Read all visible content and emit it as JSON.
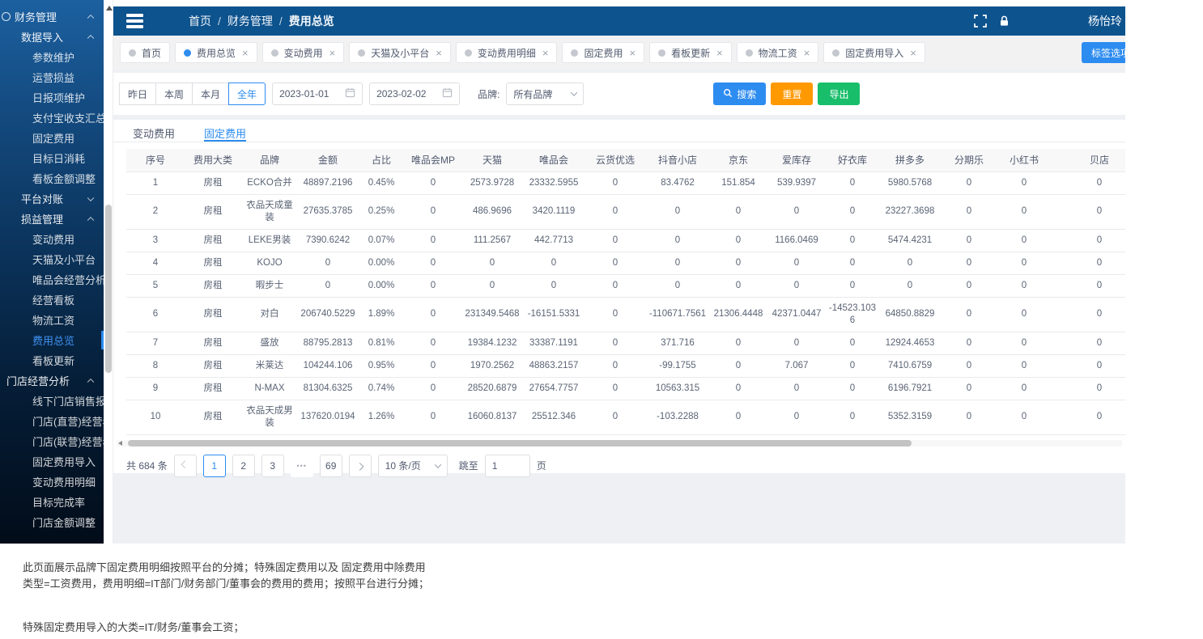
{
  "colors": {
    "primary": "#2d8cf0",
    "warning": "#ff9900",
    "success": "#19be6b",
    "header_bar": "#0d538e",
    "sidebar_active": "#3f92f2"
  },
  "icons": {
    "menu": "hamburger",
    "fullscreen": "corner-brackets",
    "lock": "padlock",
    "search": "magnifier",
    "calendar": "calendar",
    "chevron_down": "chevron-down",
    "close": "x",
    "prev": "chevron-left",
    "next": "chevron-right",
    "scroll_up": "triangle-up",
    "scroll_left": "triangle-left"
  },
  "sidebar": {
    "items": [
      {
        "label": "财务管理",
        "level": 0,
        "arrow": "up",
        "icon": true
      },
      {
        "label": "数据导入",
        "level": 1,
        "arrow": "up"
      },
      {
        "label": "参数维护",
        "level": 2
      },
      {
        "label": "运营损益",
        "level": 2
      },
      {
        "label": "日报项维护",
        "level": 2
      },
      {
        "label": "支付宝收支汇总",
        "level": 2
      },
      {
        "label": "固定费用",
        "level": 2
      },
      {
        "label": "目标日消耗",
        "level": 2
      },
      {
        "label": "看板金额调整",
        "level": 2
      },
      {
        "label": "平台对账",
        "level": 1,
        "arrow": "down"
      },
      {
        "label": "损益管理",
        "level": 1,
        "arrow": "up"
      },
      {
        "label": "变动费用",
        "level": 2
      },
      {
        "label": "天猫及小平台",
        "level": 2
      },
      {
        "label": "唯品会经营分析",
        "level": 2
      },
      {
        "label": "经营看板",
        "level": 2
      },
      {
        "label": "物流工资",
        "level": 2
      },
      {
        "label": "费用总览",
        "level": 2,
        "active": true
      },
      {
        "label": "看板更新",
        "level": 2
      },
      {
        "label": "门店经营分析",
        "level": 0,
        "arrow": "up"
      },
      {
        "label": "线下门店销售报表",
        "level": 2
      },
      {
        "label": "门店(直营)经营看板",
        "level": 2
      },
      {
        "label": "门店(联营)经营看板",
        "level": 2
      },
      {
        "label": "固定费用导入",
        "level": 2
      },
      {
        "label": "变动费用明细",
        "level": 2
      },
      {
        "label": "目标完成率",
        "level": 2
      },
      {
        "label": "门店金额调整",
        "level": 2
      }
    ]
  },
  "header": {
    "breadcrumb": {
      "items": [
        "首页",
        "财务管理",
        "费用总览"
      ],
      "separator": "/"
    },
    "user": "杨怡玲"
  },
  "tabbar": {
    "tabs": [
      {
        "label": "首页",
        "closable": false
      },
      {
        "label": "费用总览",
        "closable": true,
        "active": true
      },
      {
        "label": "变动费用",
        "closable": true
      },
      {
        "label": "天猫及小平台",
        "closable": true
      },
      {
        "label": "变动费用明细",
        "closable": true
      },
      {
        "label": "固定费用",
        "closable": true
      },
      {
        "label": "看板更新",
        "closable": true
      },
      {
        "label": "物流工资",
        "closable": true
      },
      {
        "label": "固定费用导入",
        "closable": true
      }
    ],
    "tag_button": "标签选项"
  },
  "filters": {
    "quick": [
      {
        "label": "昨日"
      },
      {
        "label": "本周"
      },
      {
        "label": "本月"
      },
      {
        "label": "全年",
        "active": true
      }
    ],
    "date_start": "2023-01-01",
    "date_end": "2023-02-02",
    "brand_label": "品牌:",
    "brand_value": "所有品牌",
    "search_label": "搜索",
    "reset_label": "重置",
    "export_label": "导出"
  },
  "subtabs": [
    {
      "label": "变动费用"
    },
    {
      "label": "固定费用",
      "active": true
    }
  ],
  "table": {
    "columns": [
      "序号",
      "费用大类",
      "品牌",
      "金额",
      "占比",
      "唯品会MP",
      "天猫",
      "唯品会",
      "云货优选",
      "抖音小店",
      "京东",
      "爱库存",
      "好衣库",
      "拼多多",
      "分期乐",
      "小红书",
      "贝店"
    ],
    "rows": [
      [
        "1",
        "房租",
        "ECKO合并",
        "48897.2196",
        "0.45%",
        "0",
        "2573.9728",
        "23332.5955",
        "0",
        "83.4762",
        "151.854",
        "539.9397",
        "0",
        "5980.5768",
        "0",
        "0",
        "0"
      ],
      [
        "2",
        "房租",
        "衣品天成童装",
        "27635.3785",
        "0.25%",
        "0",
        "486.9696",
        "3420.1119",
        "0",
        "0",
        "0",
        "0",
        "0",
        "23227.3698",
        "0",
        "0",
        "0"
      ],
      [
        "3",
        "房租",
        "LEKE男装",
        "7390.6242",
        "0.07%",
        "0",
        "111.2567",
        "442.7713",
        "0",
        "0",
        "0",
        "1166.0469",
        "0",
        "5474.4231",
        "0",
        "0",
        "0"
      ],
      [
        "4",
        "房租",
        "KOJO",
        "0",
        "0.00%",
        "0",
        "0",
        "0",
        "0",
        "0",
        "0",
        "0",
        "0",
        "0",
        "0",
        "0",
        "0"
      ],
      [
        "5",
        "房租",
        "暇步士",
        "0",
        "0.00%",
        "0",
        "0",
        "0",
        "0",
        "0",
        "0",
        "0",
        "0",
        "0",
        "0",
        "0",
        "0"
      ],
      [
        "6",
        "房租",
        "对白",
        "206740.5229",
        "1.89%",
        "0",
        "231349.5468",
        "-16151.5331",
        "0",
        "-110671.7561",
        "21306.4448",
        "42371.0447",
        "-14523.1036",
        "64850.8829",
        "0",
        "0",
        "0"
      ],
      [
        "7",
        "房租",
        "盛放",
        "88795.2813",
        "0.81%",
        "0",
        "19384.1232",
        "33387.1191",
        "0",
        "371.716",
        "0",
        "0",
        "0",
        "12924.4653",
        "0",
        "0",
        "0"
      ],
      [
        "8",
        "房租",
        "米莱达",
        "104244.106",
        "0.95%",
        "0",
        "1970.2562",
        "48863.2157",
        "0",
        "-99.1755",
        "0",
        "7.067",
        "0",
        "7410.6759",
        "0",
        "0",
        "0"
      ],
      [
        "9",
        "房租",
        "N-MAX",
        "81304.6325",
        "0.74%",
        "0",
        "28520.6879",
        "27654.7757",
        "0",
        "10563.315",
        "0",
        "0",
        "0",
        "6196.7921",
        "0",
        "0",
        "0"
      ],
      [
        "10",
        "房租",
        "衣品天成男装",
        "137620.0194",
        "1.26%",
        "0",
        "16060.8137",
        "25512.346",
        "0",
        "-103.2288",
        "0",
        "0",
        "0",
        "5352.3159",
        "0",
        "0",
        "0"
      ]
    ]
  },
  "pagination": {
    "total": "共 684 条",
    "pages": [
      {
        "label": "1",
        "active": true
      },
      {
        "label": "2"
      },
      {
        "label": "3"
      },
      {
        "label": "•••",
        "ellipsis": true
      },
      {
        "label": "69"
      }
    ],
    "page_size": "10 条/页",
    "jump_label": "跳至",
    "jump_value": "1",
    "jump_suffix": "页"
  },
  "notes": {
    "p1": "此页面展示品牌下固定费用明细按照平台的分摊；特殊固定费用以及  固定费用中除费用类型=工资费用，费用明细=IT部门/财务部门/董事会的费用的费用；按照平台进行分摊；",
    "p2": "特殊固定费用导入的大类=IT/财务/董事会工资；"
  }
}
